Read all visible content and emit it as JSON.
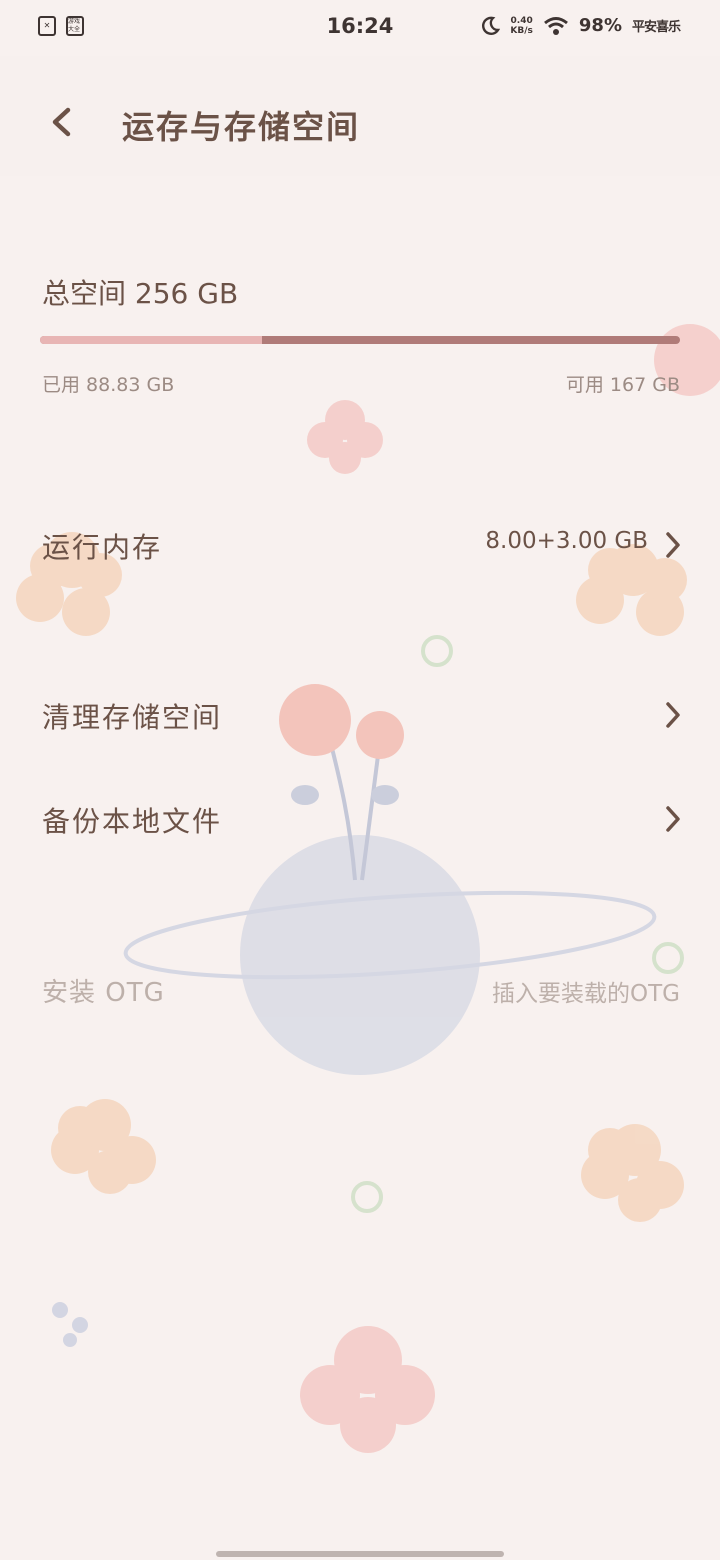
{
  "status_bar": {
    "time": "16:24",
    "left_icons": [
      "sim-off-icon",
      "game-icon"
    ],
    "game_icon_text": "游戏大全",
    "moon_icon": "moon-icon",
    "net_speed_value": "0.40",
    "net_speed_unit": "KB/s",
    "wifi_icon": "wifi-icon",
    "battery": "98%",
    "tag": "平安喜乐"
  },
  "header": {
    "title": "运存与存储空间",
    "back_icon": "chevron-left-icon"
  },
  "storage": {
    "total_label": "总空间 256 GB",
    "used_label": "已用 88.83 GB",
    "available_label": "可用 167 GB",
    "used_fraction": 0.347,
    "bar_used_color": "#e8b5b4",
    "bar_free_color": "#b07b78"
  },
  "items": [
    {
      "label": "运行内存",
      "value": "8.00+3.00 GB"
    },
    {
      "label": "清理存储空间",
      "value": ""
    },
    {
      "label": "备份本地文件",
      "value": ""
    }
  ],
  "otg": {
    "label": "安装 OTG",
    "value": "插入要装载的OTG"
  },
  "colors": {
    "text_primary": "#6b5247",
    "text_secondary": "#9c8b84",
    "text_disabled": "#bdb0aa"
  }
}
